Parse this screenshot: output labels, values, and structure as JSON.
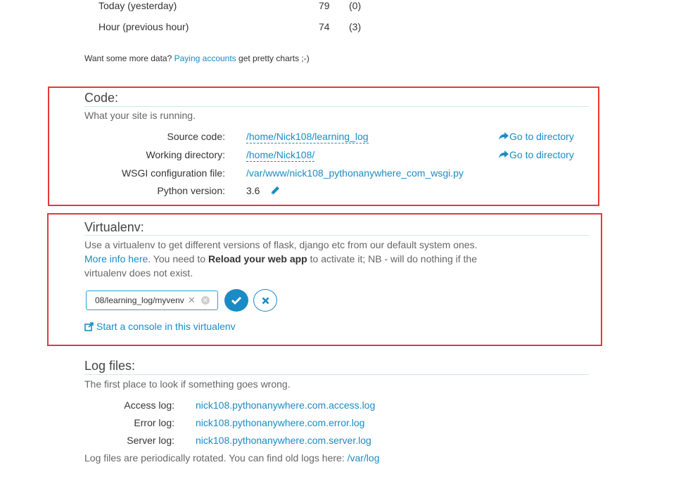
{
  "traffic": {
    "rows": [
      {
        "label": "Today (yesterday)",
        "value": "79",
        "previous": "(0)"
      },
      {
        "label": "Hour (previous hour)",
        "value": "74",
        "previous": "(3)"
      }
    ],
    "more_data_prefix": "Want some more data?",
    "more_data_link": "Paying accounts",
    "more_data_suffix": "get pretty charts ;-)"
  },
  "code": {
    "title": "Code:",
    "description": "What your site is running.",
    "source_label": "Source code:",
    "source_value": "/home/Nick108/learning_log",
    "workdir_label": "Working directory:",
    "workdir_value": "/home/Nick108/",
    "wsgi_label": "WSGI configuration file:",
    "wsgi_value": "/var/www/nick108_pythonanywhere_com_wsgi.py",
    "python_label": "Python version:",
    "python_value": "3.6",
    "goto_label": "Go to directory"
  },
  "virtualenv": {
    "title": "Virtualenv:",
    "desc_part1": "Use a virtualenv to get different versions of flask, django etc from our default system ones.",
    "desc_link": "More info here",
    "desc_part2": ". You need to",
    "desc_bold": "Reload your web app",
    "desc_part3": "to activate it; NB - will do nothing if the virtualenv does not exist.",
    "input_value": "08/learning_log/myvenv",
    "console_link": "Start a console in this virtualenv"
  },
  "logs": {
    "title": "Log files:",
    "description": "The first place to look if something goes wrong.",
    "access_label": "Access log:",
    "access_value": "nick108.pythonanywhere.com.access.log",
    "error_label": "Error log:",
    "error_value": "nick108.pythonanywhere.com.error.log",
    "server_label": "Server log:",
    "server_value": "nick108.pythonanywhere.com.server.log",
    "rotated_text": "Log files are periodically rotated. You can find old logs here:",
    "rotated_link": "/var/log"
  },
  "colors": {
    "link": "#1a8bc4",
    "highlight_border": "#e53935",
    "rule": "#cfe6f3"
  },
  "icons": [
    "share-arrow-icon",
    "pencil-icon",
    "clear-x-icon",
    "clear-circle-icon",
    "checkmark-icon",
    "cross-icon",
    "external-console-icon"
  ]
}
